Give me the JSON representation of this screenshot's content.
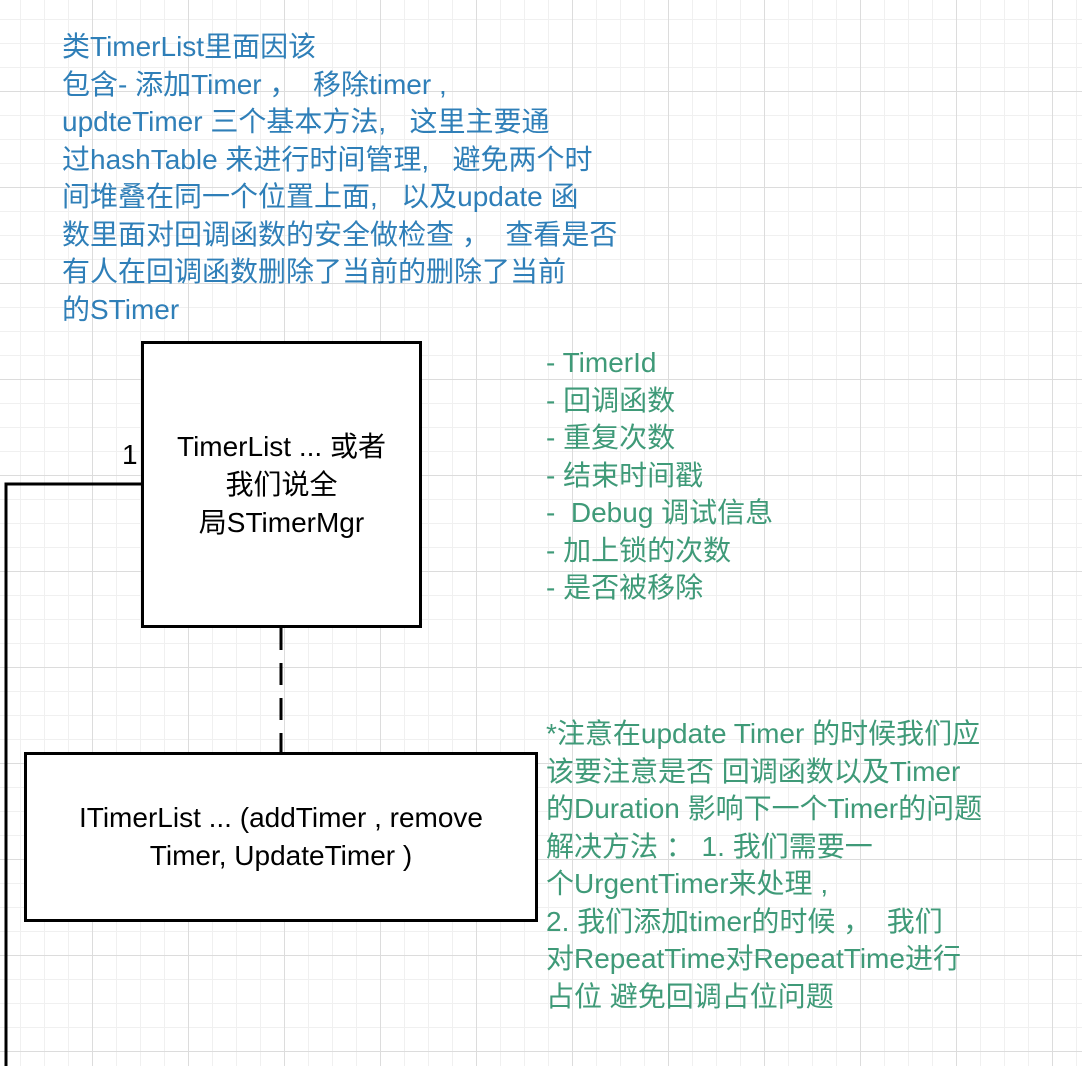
{
  "canvas": {
    "grid_color": "#dcdcdc",
    "background": "#ffffff"
  },
  "notes": {
    "class_description": "类TimerList里面因该\n包含- 添加Timer ，  移除timer ,\nupdteTimer 三个基本方法,   这里主要通\n过hashTable 来进行时间管理,   避免两个时\n间堆叠在同一个位置上面,   以及update 函\n数里面对回调函数的安全做检查 ，  查看是否\n有人在回调函数删除了当前的删除了当前\n的STimer",
    "fields": "- TimerId\n- 回调函数\n- 重复次数\n- 结束时间戳\n-  Debug 调试信息\n- 加上锁的次数\n- 是否被移除",
    "notice": "*注意在update Timer 的时候我们应\n该要注意是否 回调函数以及Timer\n的Duration 影响下一个Timer的问题\n解决方法 ： 1. 我们需要一\n个UrgentTimer来处理 ,\n2. 我们添加timer的时候 ，  我们\n对RepeatTime对RepeatTime进行\n占位 避免回调占位问题"
  },
  "colors": {
    "blue_note": "#2f7fb8",
    "green_note": "#3f9a78",
    "box_border": "#000000"
  },
  "boxes": {
    "manager": "TimerList ... 或者\n我们说全\n局STimerMgr",
    "interface": "ITimerList ... (addTimer , remove\nTimer, UpdateTimer )"
  },
  "edges": {
    "association_multiplicity": "1"
  }
}
